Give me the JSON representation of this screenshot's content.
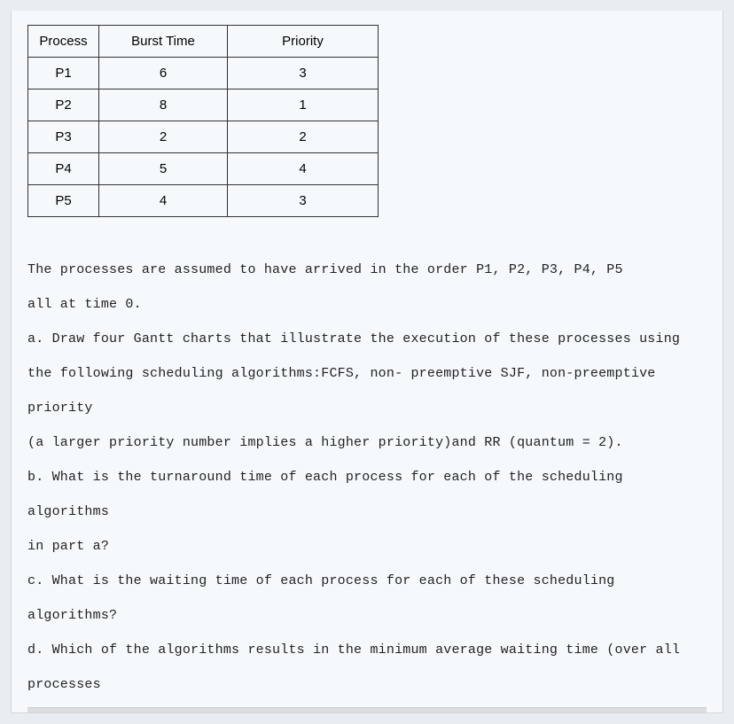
{
  "table": {
    "headers": {
      "process": "Process",
      "burst": "Burst Time",
      "priority": "Priority"
    },
    "rows": [
      {
        "process": "P1",
        "burst": "6",
        "priority": "3"
      },
      {
        "process": "P2",
        "burst": "8",
        "priority": "1"
      },
      {
        "process": "P3",
        "burst": "2",
        "priority": "2"
      },
      {
        "process": "P4",
        "burst": "5",
        "priority": "4"
      },
      {
        "process": "P5",
        "burst": "4",
        "priority": "3"
      }
    ]
  },
  "text": {
    "line1": "The processes are assumed to have arrived in the order P1, P2, P3, P4, P5",
    "line2": "all at time 0.",
    "line3": "a. Draw four Gantt charts that illustrate the execution of these processes using",
    "line4": "the following scheduling algorithms:FCFS, non- preemptive SJF, non-preemptive priority",
    "line5": "(a larger priority number implies a higher priority)and RR (quantum = 2).",
    "line6": "b. What is the turnaround time of each process for each of the scheduling algorithms",
    "line7": "in part a?",
    "line8": "c. What is the waiting time of each process for each of these scheduling algorithms?",
    "line9": "d. Which of the algorithms results in the minimum average waiting time (over all processes"
  }
}
